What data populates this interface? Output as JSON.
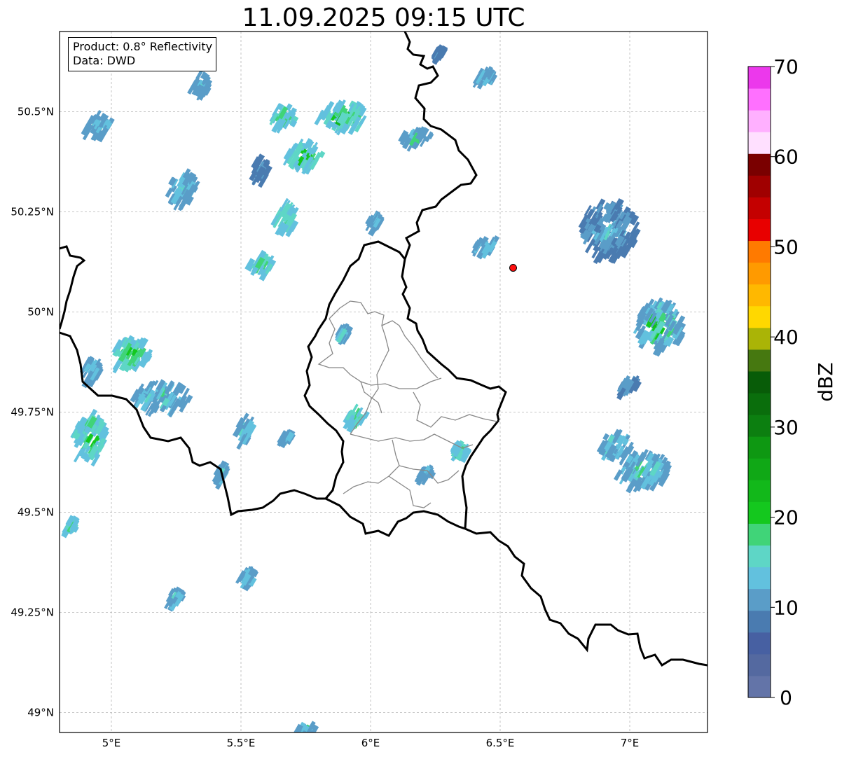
{
  "title": "11.09.2025 09:15 UTC",
  "info": {
    "product": "Product: 0.8° Reflectivity",
    "data": "Data: DWD"
  },
  "axes": {
    "lon_ticks": [
      {
        "value": 5.0,
        "label": "5°E"
      },
      {
        "value": 5.5,
        "label": "5.5°E"
      },
      {
        "value": 6.0,
        "label": "6°E"
      },
      {
        "value": 6.5,
        "label": "6.5°E"
      },
      {
        "value": 7.0,
        "label": "7°E"
      }
    ],
    "lat_ticks": [
      {
        "value": 50.5,
        "label": "50.5°N"
      },
      {
        "value": 50.25,
        "label": "50.25°N"
      },
      {
        "value": 50.0,
        "label": "50°N"
      },
      {
        "value": 49.75,
        "label": "49.75°N"
      },
      {
        "value": 49.5,
        "label": "49.5°N"
      },
      {
        "value": 49.25,
        "label": "49.25°N"
      },
      {
        "value": 49.0,
        "label": "49°N"
      }
    ],
    "lon_range": [
      4.8,
      7.3
    ],
    "lat_range": [
      48.95,
      50.7
    ],
    "grid": true
  },
  "colorbar": {
    "label": "dBZ",
    "range": [
      0,
      70
    ],
    "tick_labels": [
      {
        "value": 0,
        "label": "0"
      },
      {
        "value": 10,
        "label": "10"
      },
      {
        "value": 20,
        "label": "20"
      },
      {
        "value": 30,
        "label": "30"
      },
      {
        "value": 40,
        "label": "40"
      },
      {
        "value": 50,
        "label": "50"
      },
      {
        "value": 60,
        "label": "60"
      },
      {
        "value": 70,
        "label": "70"
      }
    ],
    "colors": [
      "#6374a8",
      "#5469a0",
      "#4760a2",
      "#4a7bb0",
      "#5a9dc8",
      "#62c1de",
      "#5ed6c6",
      "#40d478",
      "#14c81e",
      "#12b81a",
      "#10a816",
      "#0e9812",
      "#0c7f10",
      "#0a6e0c",
      "#085c08",
      "#467810",
      "#aab406",
      "#ffd800",
      "#ffb800",
      "#ff9a00",
      "#ff7a00",
      "#e80000",
      "#c40000",
      "#a00000",
      "#7a0000",
      "#ffe0ff",
      "#ffb0ff",
      "#ff70ff",
      "#ec38ec"
    ]
  },
  "marker": {
    "lon": 6.55,
    "lat": 50.11,
    "color": "#ff1010"
  },
  "echoes": [
    {
      "lon": 4.95,
      "lat": 50.48,
      "w": 0.1,
      "h": 0.06,
      "lvl": [
        4,
        6
      ]
    },
    {
      "lon": 5.35,
      "lat": 50.58,
      "w": 0.06,
      "h": 0.05,
      "lvl": [
        4,
        6
      ]
    },
    {
      "lon": 5.28,
      "lat": 50.32,
      "w": 0.12,
      "h": 0.08,
      "lvl": [
        4,
        7
      ]
    },
    {
      "lon": 5.67,
      "lat": 50.5,
      "w": 0.1,
      "h": 0.05,
      "lvl": [
        5,
        8
      ]
    },
    {
      "lon": 5.9,
      "lat": 50.5,
      "w": 0.18,
      "h": 0.07,
      "lvl": [
        5,
        9
      ]
    },
    {
      "lon": 5.75,
      "lat": 50.4,
      "w": 0.14,
      "h": 0.07,
      "lvl": [
        5,
        9
      ]
    },
    {
      "lon": 5.58,
      "lat": 50.37,
      "w": 0.05,
      "h": 0.06,
      "lvl": [
        3,
        5
      ]
    },
    {
      "lon": 5.68,
      "lat": 50.25,
      "w": 0.08,
      "h": 0.07,
      "lvl": [
        5,
        8
      ]
    },
    {
      "lon": 5.58,
      "lat": 50.13,
      "w": 0.09,
      "h": 0.05,
      "lvl": [
        5,
        8
      ]
    },
    {
      "lon": 6.02,
      "lat": 50.24,
      "w": 0.05,
      "h": 0.03,
      "lvl": [
        4,
        6
      ]
    },
    {
      "lon": 6.18,
      "lat": 50.45,
      "w": 0.12,
      "h": 0.03,
      "lvl": [
        4,
        7
      ]
    },
    {
      "lon": 6.45,
      "lat": 50.6,
      "w": 0.06,
      "h": 0.03,
      "lvl": [
        4,
        6
      ]
    },
    {
      "lon": 6.27,
      "lat": 50.66,
      "w": 0.03,
      "h": 0.02,
      "lvl": [
        3,
        5
      ]
    },
    {
      "lon": 6.45,
      "lat": 50.18,
      "w": 0.1,
      "h": 0.03,
      "lvl": [
        4,
        6
      ]
    },
    {
      "lon": 5.08,
      "lat": 49.91,
      "w": 0.15,
      "h": 0.07,
      "lvl": [
        5,
        9
      ]
    },
    {
      "lon": 4.93,
      "lat": 49.87,
      "w": 0.06,
      "h": 0.05,
      "lvl": [
        4,
        6
      ]
    },
    {
      "lon": 5.2,
      "lat": 49.8,
      "w": 0.22,
      "h": 0.07,
      "lvl": [
        4,
        7
      ]
    },
    {
      "lon": 4.92,
      "lat": 49.7,
      "w": 0.12,
      "h": 0.12,
      "lvl": [
        5,
        9
      ]
    },
    {
      "lon": 5.52,
      "lat": 49.72,
      "w": 0.06,
      "h": 0.06,
      "lvl": [
        4,
        7
      ]
    },
    {
      "lon": 5.68,
      "lat": 49.7,
      "w": 0.04,
      "h": 0.02,
      "lvl": [
        4,
        7
      ]
    },
    {
      "lon": 5.43,
      "lat": 49.61,
      "w": 0.04,
      "h": 0.04,
      "lvl": [
        4,
        6
      ]
    },
    {
      "lon": 5.95,
      "lat": 49.75,
      "w": 0.07,
      "h": 0.05,
      "lvl": [
        5,
        9
      ]
    },
    {
      "lon": 5.9,
      "lat": 49.96,
      "w": 0.04,
      "h": 0.03,
      "lvl": [
        4,
        7
      ]
    },
    {
      "lon": 6.35,
      "lat": 49.67,
      "w": 0.06,
      "h": 0.03,
      "lvl": [
        5,
        8
      ]
    },
    {
      "lon": 6.22,
      "lat": 49.61,
      "w": 0.05,
      "h": 0.02,
      "lvl": [
        4,
        6
      ]
    },
    {
      "lon": 4.85,
      "lat": 49.48,
      "w": 0.04,
      "h": 0.03,
      "lvl": [
        5,
        8
      ]
    },
    {
      "lon": 5.25,
      "lat": 49.3,
      "w": 0.05,
      "h": 0.03,
      "lvl": [
        4,
        6
      ]
    },
    {
      "lon": 5.53,
      "lat": 49.35,
      "w": 0.05,
      "h": 0.04,
      "lvl": [
        4,
        7
      ]
    },
    {
      "lon": 5.75,
      "lat": 48.97,
      "w": 0.07,
      "h": 0.03,
      "lvl": [
        4,
        7
      ]
    },
    {
      "lon": 6.92,
      "lat": 50.22,
      "w": 0.22,
      "h": 0.14,
      "lvl": [
        3,
        6
      ]
    },
    {
      "lon": 7.12,
      "lat": 49.98,
      "w": 0.18,
      "h": 0.12,
      "lvl": [
        4,
        10
      ]
    },
    {
      "lon": 7.0,
      "lat": 49.83,
      "w": 0.07,
      "h": 0.04,
      "lvl": [
        3,
        5
      ]
    },
    {
      "lon": 7.05,
      "lat": 49.62,
      "w": 0.2,
      "h": 0.08,
      "lvl": [
        4,
        8
      ]
    },
    {
      "lon": 6.95,
      "lat": 49.68,
      "w": 0.12,
      "h": 0.06,
      "lvl": [
        4,
        7
      ]
    }
  ]
}
